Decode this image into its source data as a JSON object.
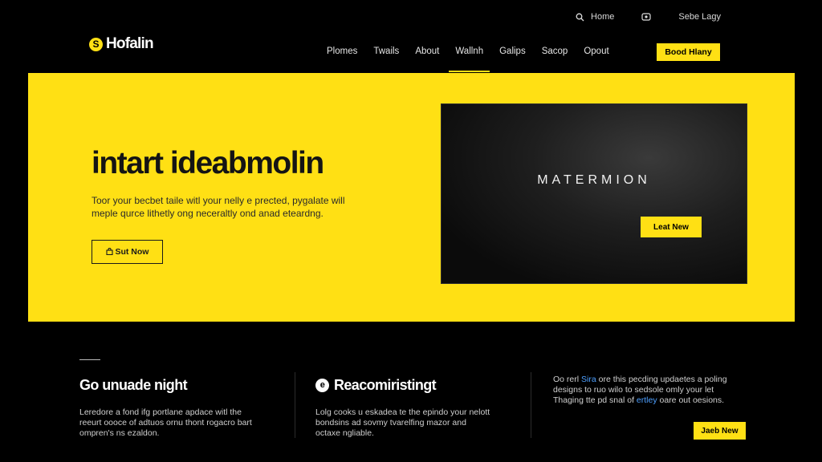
{
  "utility": {
    "home_label": "Home",
    "account_label": "Sebe Lagy",
    "icons": [
      "search-icon",
      "user-icon"
    ]
  },
  "brand": {
    "name": "Hofalin",
    "mark": "S"
  },
  "nav": {
    "items": [
      "Plomes",
      "Twails",
      "About",
      "Wallnh",
      "Galips",
      "Sacop",
      "Opout"
    ],
    "active_index": 3
  },
  "header_cta": "Bood Hlany",
  "hero": {
    "title": "intart ideabmolin",
    "desc_line1": "Toor your becbet taile witl your nelly e prected, pygalate will",
    "desc_line2": "meple qurce lithetly ong neceraltly ond anad eteardng.",
    "button_label": "Sut Now",
    "button_icon": "bag-icon",
    "media_title": "MATERMION",
    "media_button": "Leat New",
    "accent_color": "#ffe014"
  },
  "columns": [
    {
      "title": "Go unuade night",
      "text": [
        "Leredore a fond ifg portlane apdace witl the",
        "reeurt oooce of adtuos ornu thont rogacro bart",
        "ompren's ns ezaldon."
      ]
    },
    {
      "title": "Reacomiristingt",
      "icon": "circle-e-icon",
      "text": [
        "Lolg cooks u eskadea te the epindo your nelott",
        "bondsins ad sovmy tvarelfing mazor and",
        "octaxe ngliable."
      ]
    },
    {
      "text_pre": "Oo rerl ",
      "text_hl1": "Sira",
      "text_mid": " ore this pecding updaetes a poling",
      "text2": "designs to ruo wilo to sedsole omly your let",
      "text3_pre": "Thaging tte pd snal of ",
      "text_hl2": "ertley",
      "text3_post": " oare out oesions.",
      "button_label": "Jaeb New"
    }
  ]
}
